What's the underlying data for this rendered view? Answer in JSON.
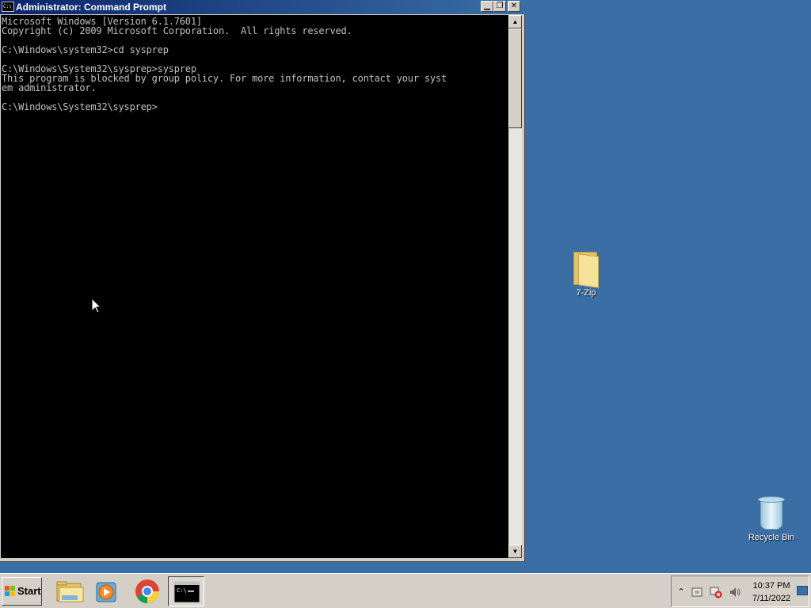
{
  "window": {
    "title": "Administrator: Command Prompt",
    "icon_text": "C:\\",
    "buttons": {
      "minimize": "▁",
      "maximize": "❐",
      "close": "✕"
    }
  },
  "console": {
    "lines": [
      "Microsoft Windows [Version 6.1.7601]",
      "Copyright (c) 2009 Microsoft Corporation.  All rights reserved.",
      "",
      "C:\\Windows\\system32>cd sysprep",
      "",
      "C:\\Windows\\System32\\sysprep>sysprep",
      "This program is blocked by group policy. For more information, contact your syst",
      "em administrator.",
      "",
      "C:\\Windows\\System32\\sysprep>"
    ],
    "text_color": "#c0c0c0",
    "background": "#000000"
  },
  "scrollbar": {
    "up_glyph": "▲",
    "down_glyph": "▼"
  },
  "desktop": {
    "background": "#3a6ea5",
    "icons": [
      {
        "label": "7-Zip",
        "icon": "folder-icon"
      },
      {
        "label": "Recycle Bin",
        "icon": "recycle-bin-icon"
      }
    ]
  },
  "taskbar": {
    "start_label": "Start",
    "pinned": [
      {
        "name": "windows-explorer",
        "icon": "folder-icon"
      },
      {
        "name": "media-player",
        "icon": "media-player-icon"
      },
      {
        "name": "chrome",
        "icon": "chrome-icon"
      },
      {
        "name": "command-prompt",
        "icon": "cmd-icon",
        "active": true
      }
    ],
    "tray": {
      "expand_glyph": "⌃",
      "clock_time": "10:37 PM",
      "clock_date": "7/11/2022"
    }
  }
}
